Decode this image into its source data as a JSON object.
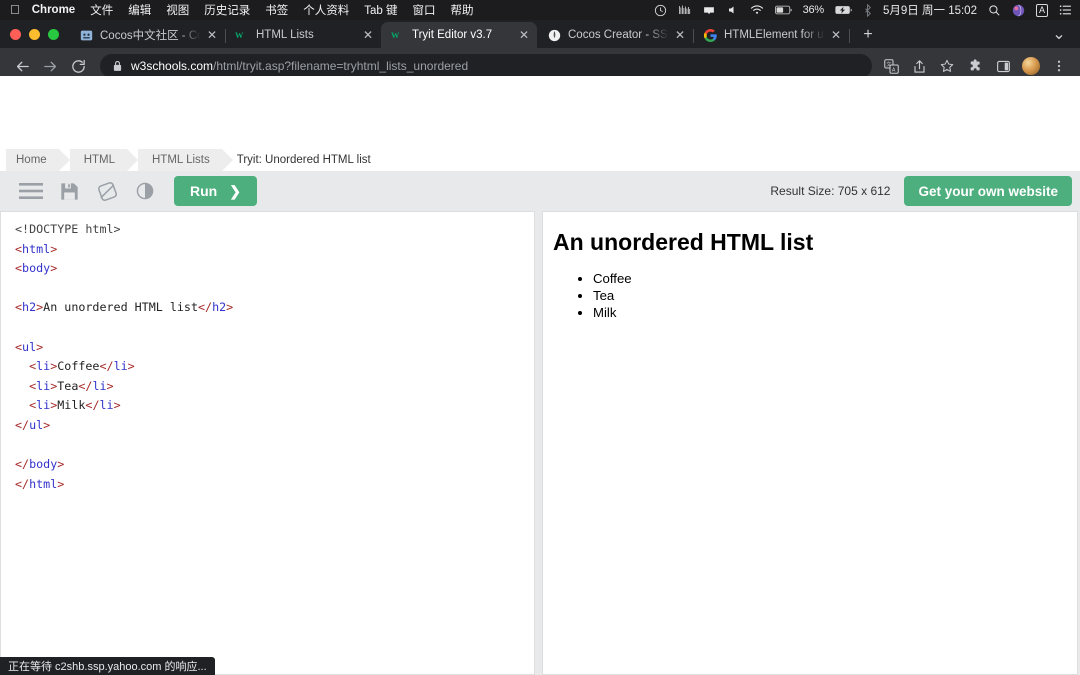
{
  "menubar": {
    "apple_icon": "apple-icon",
    "app_name": "Chrome",
    "items": [
      "文件",
      "编辑",
      "视图",
      "历史记录",
      "书签",
      "个人资料",
      "Tab 键",
      "窗口",
      "帮助"
    ],
    "status": {
      "battery_percent": "36%",
      "datetime": "5月9日 周一  15:02",
      "icons": [
        "timemachine-icon",
        "wifi-signal-icon",
        "notification-icon",
        "volume-icon",
        "wifi-icon",
        "battery-icon",
        "bluetooth-icon",
        "search-icon",
        "globe-icon",
        "input-source-icon",
        "control-center-icon"
      ],
      "input_source_label": "A"
    }
  },
  "browser": {
    "tabs": [
      {
        "title": "Cocos中文社区 - Cocos中文社区",
        "favicon": "cocos-community-favicon",
        "active": false
      },
      {
        "title": "HTML Lists",
        "favicon": "w3schools-favicon",
        "active": false
      },
      {
        "title": "Tryit Editor v3.7",
        "favicon": "w3schools-favicon",
        "active": true
      },
      {
        "title": "Cocos Creator - SSRExtension",
        "favicon": "cocos-creator-favicon",
        "active": false
      },
      {
        "title": "HTMLElement for ul – Google S",
        "favicon": "google-favicon",
        "active": false
      }
    ],
    "new_tab_label": "+",
    "tab_search_label": "⌄",
    "close_label": "✕",
    "nav": {
      "back": "←",
      "forward": "→",
      "reload": "⟳"
    },
    "url": {
      "host": "w3schools.com",
      "path": "/html/tryit.asp?filename=tryhtml_lists_unordered",
      "lock_icon": "lock-icon"
    },
    "toolbar_icons": [
      "translate-icon",
      "share-icon",
      "bookmark-star-icon",
      "extensions-icon",
      "sidebar-icon",
      "profile-avatar",
      "kebab-menu-icon"
    ],
    "status_text": "正在等待 c2shb.ssp.yahoo.com 的响应..."
  },
  "page": {
    "breadcrumb": [
      {
        "label": "Home",
        "current": false
      },
      {
        "label": "HTML",
        "current": false
      },
      {
        "label": "HTML Lists",
        "current": false
      },
      {
        "label": "Tryit: Unordered HTML list",
        "current": true
      }
    ],
    "toolbar": {
      "menu_icon": "hamburger-menu-icon",
      "save_icon": "save-floppy-icon",
      "orientation_icon": "change-orientation-icon",
      "theme_icon": "dark-mode-toggle-icon",
      "run_label": "Run",
      "run_arrow": "❯",
      "result_size": "Result Size: 705 x 612",
      "get_website_label": "Get your own website",
      "accent_color": "#4CAF7D"
    },
    "editor": {
      "lines": [
        [
          {
            "t": "doctype",
            "s": "<!DOCTYPE html>"
          }
        ],
        [
          {
            "t": "tagp",
            "s": "<"
          },
          {
            "t": "tagn",
            "s": "html"
          },
          {
            "t": "tagp",
            "s": ">"
          }
        ],
        [
          {
            "t": "tagp",
            "s": "<"
          },
          {
            "t": "tagn",
            "s": "body"
          },
          {
            "t": "tagp",
            "s": ">"
          }
        ],
        [],
        [
          {
            "t": "tagp",
            "s": "<"
          },
          {
            "t": "tagn",
            "s": "h2"
          },
          {
            "t": "tagp",
            "s": ">"
          },
          {
            "t": "txt",
            "s": "An unordered HTML list"
          },
          {
            "t": "tagp",
            "s": "</"
          },
          {
            "t": "tagn",
            "s": "h2"
          },
          {
            "t": "tagp",
            "s": ">"
          }
        ],
        [],
        [
          {
            "t": "tagp",
            "s": "<"
          },
          {
            "t": "tagn",
            "s": "ul"
          },
          {
            "t": "tagp",
            "s": ">"
          }
        ],
        [
          {
            "t": "txt",
            "s": "  "
          },
          {
            "t": "tagp",
            "s": "<"
          },
          {
            "t": "tagn",
            "s": "li"
          },
          {
            "t": "tagp",
            "s": ">"
          },
          {
            "t": "txt",
            "s": "Coffee"
          },
          {
            "t": "tagp",
            "s": "</"
          },
          {
            "t": "tagn",
            "s": "li"
          },
          {
            "t": "tagp",
            "s": ">"
          }
        ],
        [
          {
            "t": "txt",
            "s": "  "
          },
          {
            "t": "tagp",
            "s": "<"
          },
          {
            "t": "tagn",
            "s": "li"
          },
          {
            "t": "tagp",
            "s": ">"
          },
          {
            "t": "txt",
            "s": "Tea"
          },
          {
            "t": "tagp",
            "s": "</"
          },
          {
            "t": "tagn",
            "s": "li"
          },
          {
            "t": "tagp",
            "s": ">"
          }
        ],
        [
          {
            "t": "txt",
            "s": "  "
          },
          {
            "t": "tagp",
            "s": "<"
          },
          {
            "t": "tagn",
            "s": "li"
          },
          {
            "t": "tagp",
            "s": ">"
          },
          {
            "t": "txt",
            "s": "Milk"
          },
          {
            "t": "tagp",
            "s": "</"
          },
          {
            "t": "tagn",
            "s": "li"
          },
          {
            "t": "tagp",
            "s": ">"
          }
        ],
        [
          {
            "t": "tagp",
            "s": "</"
          },
          {
            "t": "tagn",
            "s": "ul"
          },
          {
            "t": "tagp",
            "s": ">"
          }
        ],
        [],
        [
          {
            "t": "tagp",
            "s": "</"
          },
          {
            "t": "tagn",
            "s": "body"
          },
          {
            "t": "tagp",
            "s": ">"
          }
        ],
        [
          {
            "t": "tagp",
            "s": "</"
          },
          {
            "t": "tagn",
            "s": "html"
          },
          {
            "t": "tagp",
            "s": ">"
          }
        ]
      ]
    },
    "result": {
      "heading": "An unordered HTML list",
      "list_items": [
        "Coffee",
        "Tea",
        "Milk"
      ]
    }
  }
}
